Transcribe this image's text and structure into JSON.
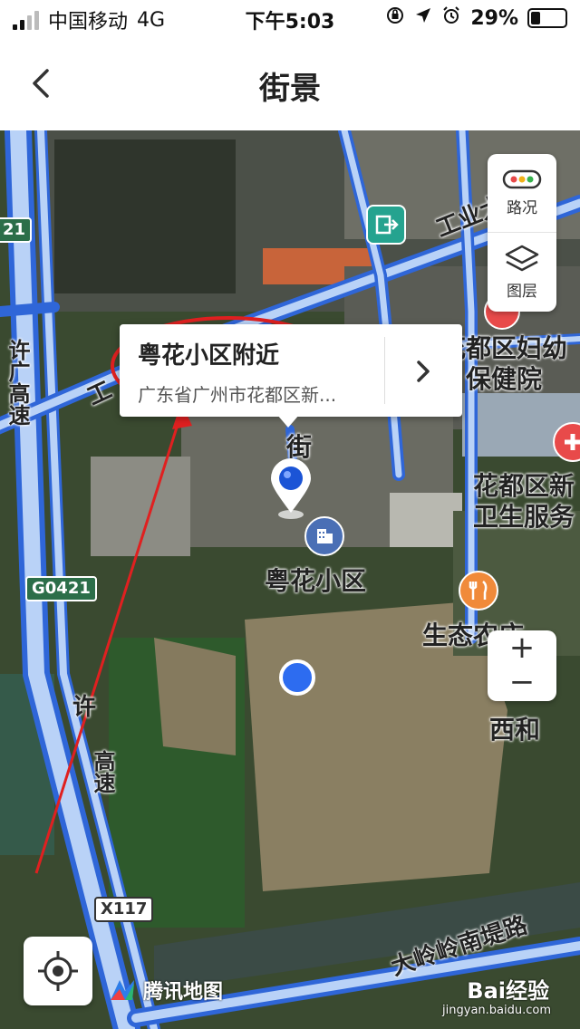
{
  "status_bar": {
    "carrier": "中国移动",
    "network": "4G",
    "time": "下午5:03",
    "battery": "29%"
  },
  "nav": {
    "title": "街景"
  },
  "popup": {
    "name": "粤花小区附近",
    "address": "广东省广州市花都区新..."
  },
  "map_controls": {
    "traffic_label": "路况",
    "layers_label": "图层",
    "zoom_in": "+",
    "zoom_out": "−"
  },
  "map_labels": {
    "road_gongye_top": "工业大道",
    "road_gongye_left": "工",
    "road_xuguang": "许广高速",
    "road_xu_lower": "许",
    "road_gaosu_lower": "高速",
    "street_label": "街",
    "hospital": "花都区妇幼保健院",
    "health_center": "花都区新卫生服务",
    "yuehua": "粤花小区",
    "eco_farm": "生态农庄",
    "xihe": "西和",
    "dalingnan": "大岭岭南堤路"
  },
  "shields": {
    "g0421_top": "21",
    "g0421": "G0421",
    "x117": "X117"
  },
  "brand": {
    "name": "腾讯地图"
  },
  "watermark": {
    "main": "Bai经验",
    "sub": "jingyan.baidu.com"
  }
}
